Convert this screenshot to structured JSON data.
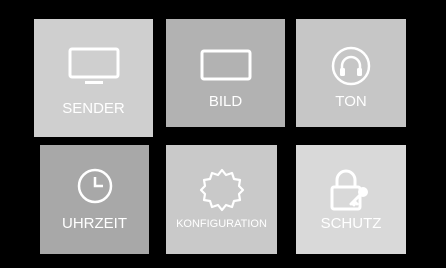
{
  "menu": {
    "tiles": [
      {
        "id": "sender",
        "label": "SENDER",
        "icon": "tv-icon"
      },
      {
        "id": "bild",
        "label": "BILD",
        "icon": "screen-icon"
      },
      {
        "id": "ton",
        "label": "TON",
        "icon": "headphones-icon"
      },
      {
        "id": "uhrzeit",
        "label": "UHRZEIT",
        "icon": "clock-icon"
      },
      {
        "id": "konfiguration",
        "label": "KONFIGURATION",
        "icon": "gear-icon"
      },
      {
        "id": "schutz",
        "label": "SCHUTZ",
        "icon": "lock-key-icon"
      }
    ]
  },
  "colors": {
    "background": "#000000",
    "tile_sender": "#cfcfcf",
    "tile_bild": "#b2b2b2",
    "tile_ton": "#c6c6c6",
    "tile_uhrzeit": "#a8a8a8",
    "tile_konfiguration": "#c9c9c9",
    "tile_schutz": "#d9d9d9",
    "icon_stroke": "#ffffff"
  }
}
